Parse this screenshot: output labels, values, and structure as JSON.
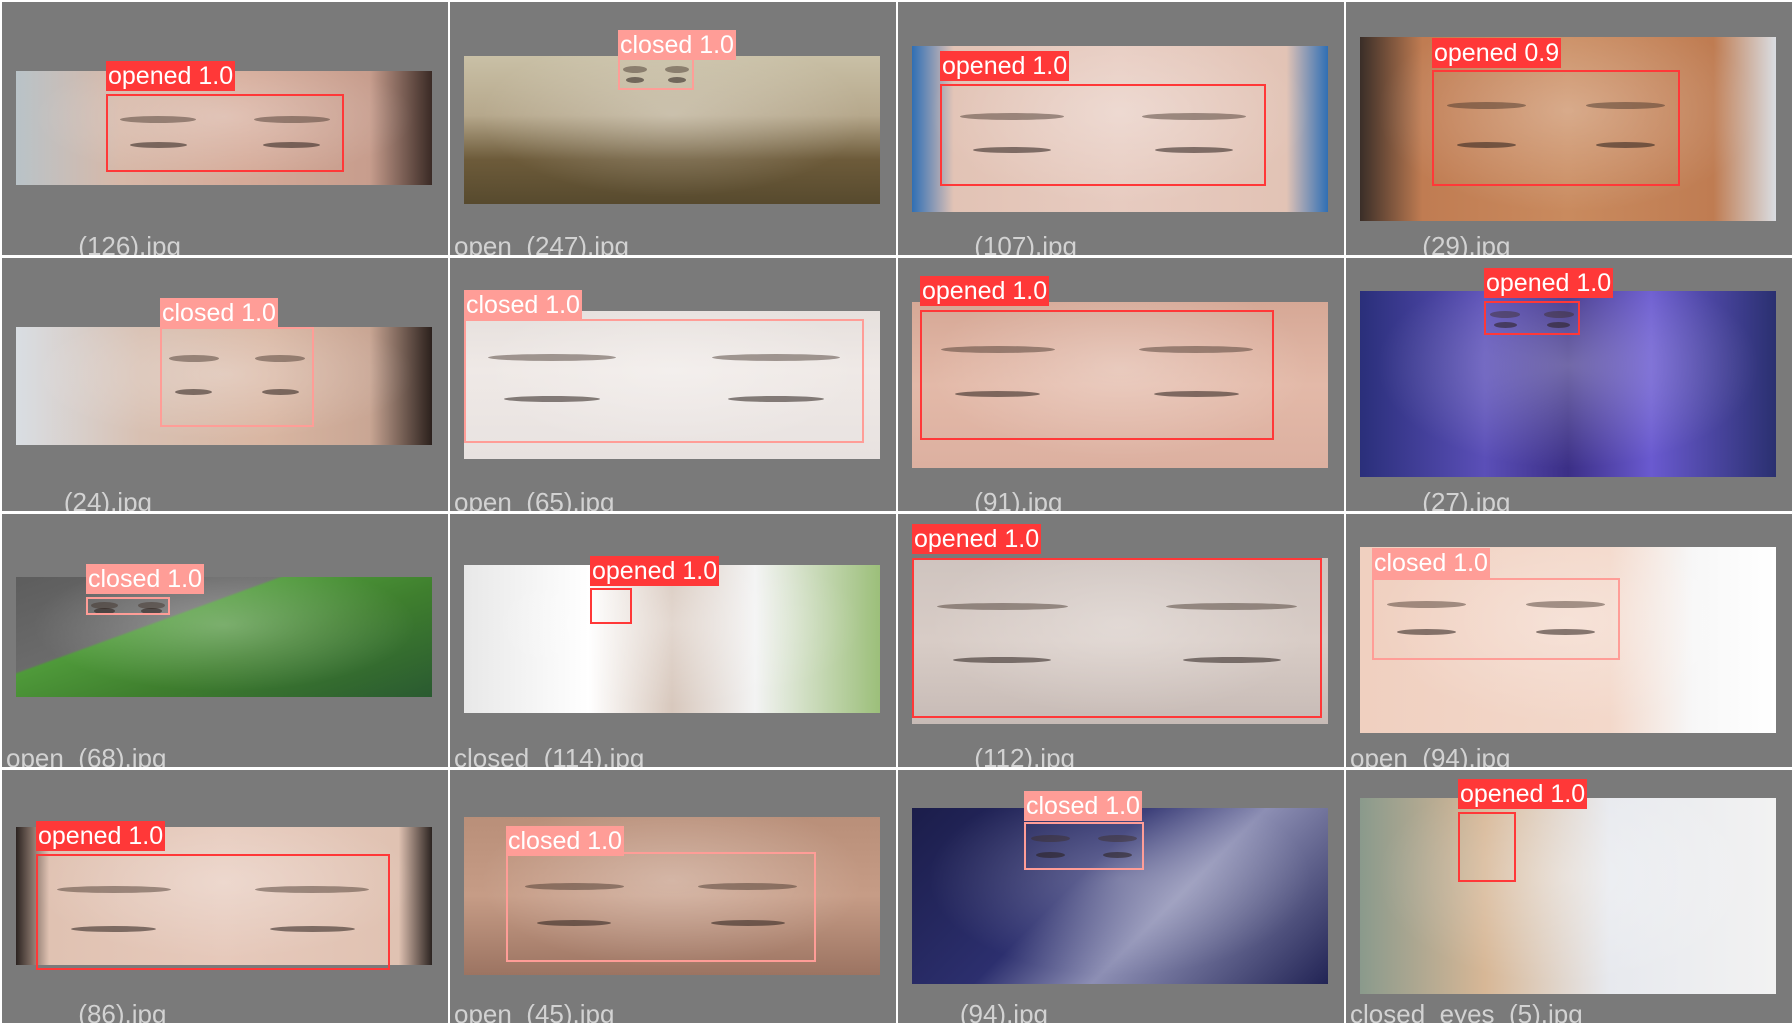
{
  "colors": {
    "opened": "#ff3838",
    "closed": "#ff9d97",
    "background": "#7a7a7a",
    "grid": "#ffffff"
  },
  "tiles": [
    {
      "file": "_____(126).jpg",
      "label": "opened 1.0",
      "cls": "opened",
      "bg": "linear-gradient(90deg,#b9c3c8 0%,#d7b8a8 25%,#d5aa98 55%,#c79d8d 85%,#3a2a25 100%)"
    },
    {
      "file": "open_(247).jpg",
      "label": "closed 1.0",
      "cls": "closed",
      "bg": "linear-gradient(180deg,#c9c0a6 0%,#b6a88c 40%,#6d5b3a 70%,#574a2e 100%)"
    },
    {
      "file": "_____(107).jpg",
      "label": "opened 1.0",
      "cls": "opened",
      "bg": "linear-gradient(90deg,#2f6fb5 0%,#e2c3b5 10%,#e7cbc0 50%,#e2c3b5 90%,#2f6fb5 100%)"
    },
    {
      "file": "_____(29).jpg",
      "label": "opened 0.9",
      "cls": "opened",
      "bg": "linear-gradient(90deg,#3a2e28 0%,#c07c52 15%,#c98a5e 50%,#bf7c52 85%,#dadde2 100%)"
    },
    {
      "file": "____(24).jpg",
      "label": "closed 1.0",
      "cls": "closed",
      "bg": "linear-gradient(90deg,#d9dee3 0%,#d8c0b2 30%,#d9b6a2 60%,#c9a694 85%,#2b201c 100%)"
    },
    {
      "file": "open_(65).jpg",
      "label": "closed 1.0",
      "cls": "closed",
      "bg": "linear-gradient(180deg,#e6e0dd 0%,#efe9e6 40%,#e8e2e0 100%)"
    },
    {
      "file": "_____(91).jpg",
      "label": "opened 1.0",
      "cls": "opened",
      "bg": "linear-gradient(180deg,#d6a896 0%,#e3b9a8 50%,#dcb0a0 100%)"
    },
    {
      "file": "_____(27).jpg",
      "label": "opened 1.0",
      "cls": "opened",
      "bg": "linear-gradient(90deg,#2a2f7a 0%,#5b4fb8 30%,#3b2f86 50%,#6a5ad0 70%,#2a3070 100%)"
    },
    {
      "file": "open_(68).jpg",
      "label": "closed 1.0",
      "cls": "closed",
      "bg": "linear-gradient(160deg,#5d5d5d 0%,#6b6b6b 35%,#4f9a3a 36%,#3f7f2e 60%,#2a5a30 100%)"
    },
    {
      "file": "closed_(114).jpg",
      "label": "opened 1.0",
      "cls": "opened",
      "bg": "linear-gradient(90deg,#e8e8e8 0%,#ffffff 30%,#d8c8bd 50%,#f3f3f3 70%,#9cbf7a 100%)"
    },
    {
      "file": "_____(112).jpg",
      "label": "opened 1.0",
      "cls": "opened",
      "bg": "linear-gradient(180deg,#cfc4bf 0%,#d8ccc6 50%,#c7bbb6 100%)"
    },
    {
      "file": "open_(94).jpg",
      "label": "closed 1.0",
      "cls": "closed",
      "bg": "linear-gradient(90deg,#f0d0c0 0%,#f3d8ca 60%,#f7f7f7 80%,#ffffff 100%)"
    },
    {
      "file": "_____(86).jpg",
      "label": "opened 1.0",
      "cls": "opened",
      "bg": "linear-gradient(90deg,#2b2320 0%,#e0c2b2 8%,#e6c9bb 50%,#e0c2b2 92%,#2b2320 100%)"
    },
    {
      "file": "open_(45).jpg",
      "label": "closed 1.0",
      "cls": "closed",
      "bg": "linear-gradient(180deg,#b98f79 0%,#c69c86 50%,#9c7462 100%)"
    },
    {
      "file": "____(94).jpg",
      "label": "closed 1.0",
      "cls": "closed",
      "bg": "linear-gradient(135deg,#1b1d4a 0%,#2c2f6e 40%,#8d8fb4 60%,#222455 100%)"
    },
    {
      "file": "closed_eyes_(5).jpg",
      "label": "opened 1.0",
      "cls": "opened",
      "bg": "linear-gradient(90deg,#8a9a8c 0%,#d7b796 30%,#e7e9ee 60%,#f2f2f2 100%)"
    }
  ]
}
